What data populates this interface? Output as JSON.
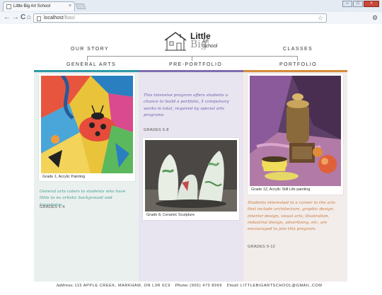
{
  "browser": {
    "tab_title": "Little Big Art School",
    "tab_close": "×",
    "url_host": "localhost",
    "url_path": "/lbas/",
    "back": "←",
    "forward": "→",
    "reload": "C",
    "home": "⌂",
    "bookmark": "☆",
    "menu": "⚙",
    "window_minimize": "–",
    "window_maximize": "□",
    "window_close": "×"
  },
  "header": {
    "logo": {
      "word1": "Little",
      "word2": "Big",
      "word3": "Art",
      "word4": "School"
    },
    "nav": {
      "our_story": "OUR STORY",
      "classes": "CLASSES"
    }
  },
  "categories": {
    "general": "GENERAL ARTS",
    "pre_portfolio": "PRE-PORTFOLIO",
    "portfolio": "PORTFOLIO"
  },
  "colors": {
    "general": "#2f9aa6",
    "pre_portfolio": "#7d6bb2",
    "portfolio": "#d58c3e"
  },
  "general": {
    "caption": "Grade 1, Acrylic Painting",
    "description": "General arts caters to students who have little to no artistic background and knowledge.",
    "grades": "GRADES 1-4"
  },
  "pre_portfolio": {
    "description": "This intensive program offers students a chance to build a portfolio, 5 compulsory works in total, required by special arts programs",
    "grades": "GRADES 5-8",
    "caption": "Grade 8, Ceramic Sculpture"
  },
  "portfolio": {
    "caption": "Grade 12, Acrylic Still Life painting",
    "description": "Students interested in a career in the arts that include architecture, graphic design, interior design, visual arts, illustration, industrial design, advertising, etc. are encouraged to join this program.",
    "grades": "GRADES 9-12"
  },
  "footer": {
    "address_label": "Address:",
    "address": "115 APPLE CREEK, MARKHAM, ON L3R 6C9",
    "phone_label": "Phone:",
    "phone": "(905) 470 8999",
    "email_label": "Email:",
    "email": "LITTLEBIGARTSCHOOL@GMAIL.COM"
  }
}
